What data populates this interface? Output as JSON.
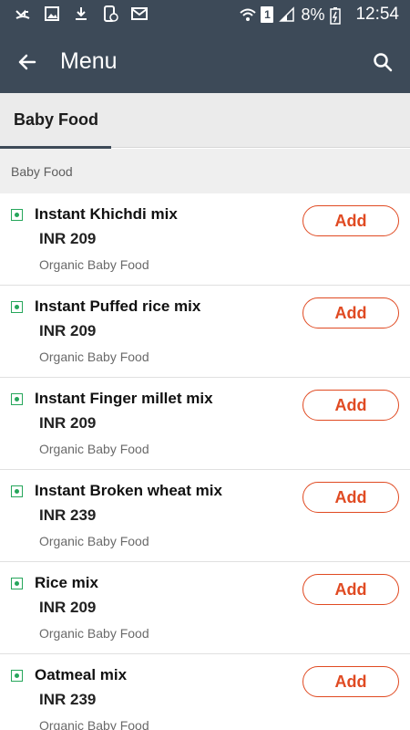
{
  "status_bar": {
    "battery": "8%",
    "time": "12:54",
    "sim_label": "1",
    "left_icons": [
      "missed-call-icon",
      "image-icon",
      "download-icon",
      "call-icon",
      "mail-icon"
    ],
    "right_icons": [
      "wifi-icon",
      "sim-icon",
      "signal-icon",
      "battery-icon"
    ]
  },
  "app_bar": {
    "title": "Menu",
    "back_icon": "arrow-left-icon",
    "search_icon": "search-icon",
    "background": "#3d4a58"
  },
  "tabs": [
    {
      "label": "Baby Food",
      "active": true
    }
  ],
  "section": {
    "title": "Baby Food"
  },
  "items": [
    {
      "name": "Instant Khichdi mix",
      "price": "INR 209",
      "category": "Organic Baby Food",
      "button": "Add"
    },
    {
      "name": "Instant Puffed rice mix",
      "price": "INR 209",
      "category": "Organic Baby Food",
      "button": "Add"
    },
    {
      "name": "Instant Finger millet mix",
      "price": "INR 209",
      "category": "Organic Baby Food",
      "button": "Add"
    },
    {
      "name": "Instant Broken wheat mix",
      "price": "INR 239",
      "category": "Organic Baby Food",
      "button": "Add"
    },
    {
      "name": "Rice mix",
      "price": "INR 209",
      "category": "Organic Baby Food",
      "button": "Add"
    },
    {
      "name": "Oatmeal mix",
      "price": "INR 239",
      "category": "Organic Baby Food",
      "button": "Add"
    }
  ],
  "colors": {
    "accent": "#e04a22",
    "veg_mark": "#26a65b",
    "header": "#3d4a58"
  }
}
